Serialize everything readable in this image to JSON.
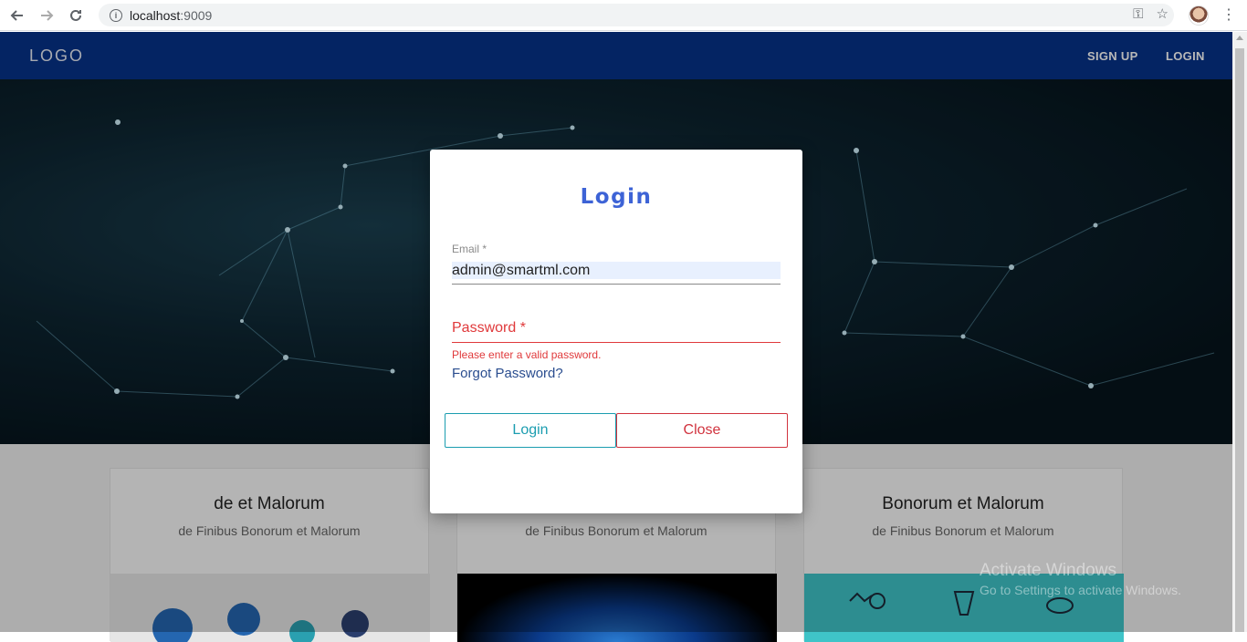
{
  "browser": {
    "url_host": "localhost",
    "url_port": ":9009",
    "nav_back_icon": "arrow-left-icon",
    "nav_forward_icon": "arrow-right-icon",
    "nav_reload_icon": "reload-icon",
    "info_icon": "i"
  },
  "header": {
    "logo": "LOGO",
    "nav": {
      "signup": "SIGN UP",
      "login": "LOGIN"
    },
    "color": "#06328a"
  },
  "cards": [
    {
      "title": "de et Malorum",
      "subtitle": "de Finibus Bonorum et Malorum"
    },
    {
      "title": "",
      "subtitle": "de Finibus Bonorum et Malorum"
    },
    {
      "title": "Bonorum et Malorum",
      "subtitle": "de Finibus Bonorum et Malorum"
    }
  ],
  "modal": {
    "title": "Login",
    "email": {
      "label": "Email *",
      "value": "admin@smartml.com"
    },
    "password": {
      "label": "Password *",
      "error": "Please enter a valid password."
    },
    "forgot_link": "Forgot Password?",
    "buttons": {
      "login": "Login",
      "close": "Close"
    },
    "accent": "#3d63d6"
  },
  "watermark": {
    "title": "Activate Windows",
    "subtitle": "Go to Settings to activate Windows."
  }
}
